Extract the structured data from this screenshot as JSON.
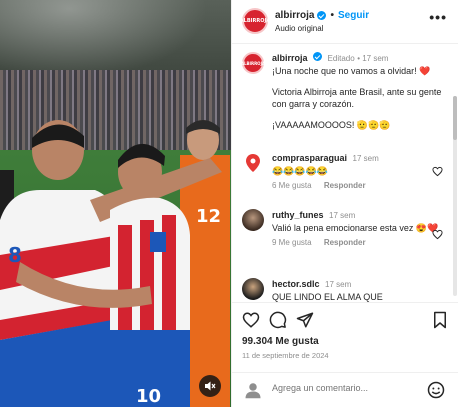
{
  "media": {
    "mute_icon": "speaker-muted-icon"
  },
  "header": {
    "avatar_text": "ALBIRROJA",
    "username": "albirroja",
    "separator": "•",
    "follow_label": "Seguir",
    "audio_label": "Audio original",
    "more_label": "•••"
  },
  "caption": {
    "avatar_text": "ALBIRROJA",
    "username": "albirroja",
    "edited": "Editado",
    "time": "17 sem",
    "line1": "¡Una noche que no vamos a olvidar! ❤️",
    "line2": "Victoria Albirroja ante Brasil, ante su gente con garra y corazón.",
    "line3": "¡VAAAAAMOOOOS! 🫡🫡🫡"
  },
  "comments": [
    {
      "username": "comprasparaguai",
      "time": "17 sem",
      "text": "😂😂😂😂😂",
      "likes": "6 Me gusta",
      "reply": "Responder"
    },
    {
      "username": "ruthy_funes",
      "time": "17 sem",
      "text": "Valió la pena emocionarse esta vez 😍❤️",
      "likes": "9 Me gusta",
      "reply": "Responder"
    },
    {
      "username": "hector.sdlc",
      "time": "17 sem",
      "text": "QUE LINDO EL ALMA QUE"
    }
  ],
  "actions": {
    "likes": "99.304 Me gusta",
    "date": "11 de septiembre de 2024"
  },
  "add_comment": {
    "placeholder": "Agrega un comentario..."
  },
  "colors": {
    "accent": "#0095f6",
    "brand": "#d7232f",
    "muted": "#8e8e8e"
  }
}
